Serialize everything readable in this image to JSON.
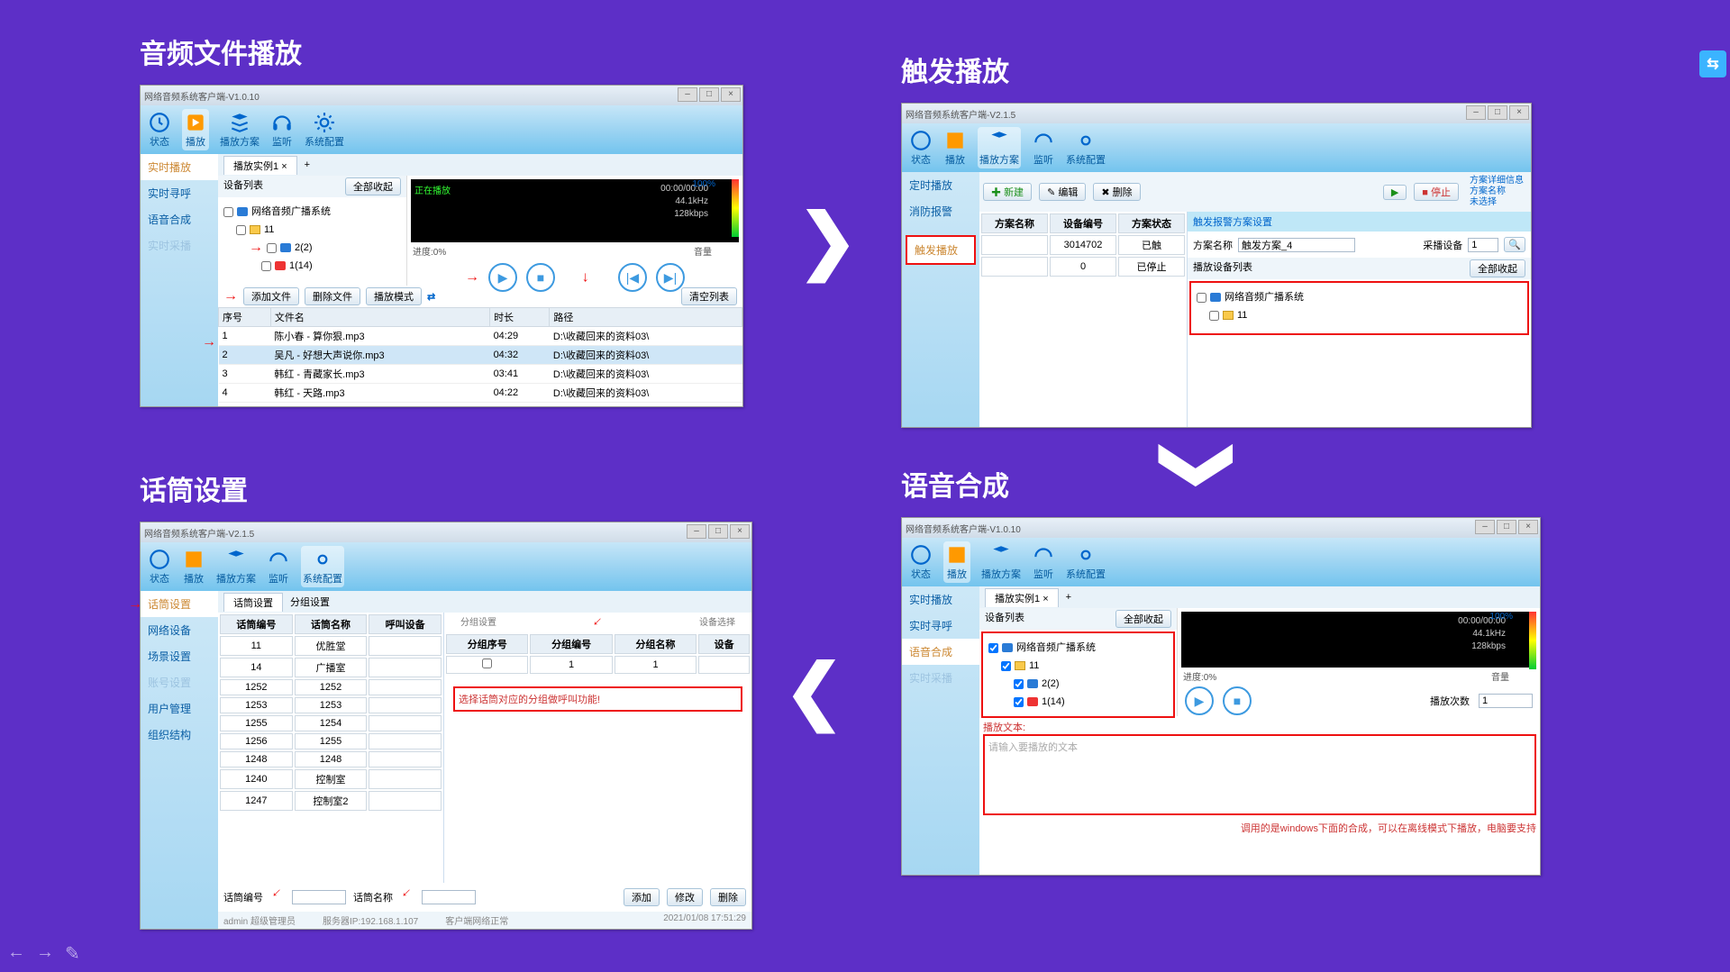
{
  "share_icon": "⇆",
  "nav": {
    "prev": "←",
    "next": "→",
    "pen": "✎"
  },
  "panel1": {
    "title": "音频文件播放",
    "win_title": "网络音频系统客户端-V1.0.10",
    "toolbar": [
      "状态",
      "播放",
      "播放方案",
      "监听",
      "系统配置"
    ],
    "left": [
      "实时播放",
      "实时寻呼",
      "语音合成",
      "实时采播"
    ],
    "tab": "播放实例1",
    "tab_close": "×",
    "tab_add": "+",
    "tree_header": "设备列表",
    "expand_all": "全部收起",
    "tree": {
      "root": "网络音频广播系统",
      "g1": "11",
      "s1": "2(2)",
      "s2": "1(14)"
    },
    "player": {
      "status": "正在播放",
      "time": "00:00/00:00",
      "pct": "100%",
      "rate": "44.1kHz",
      "bps": "128kbps",
      "prog": "进度:0%",
      "vol": "音量"
    },
    "btns": {
      "addfile": "添加文件",
      "delfile": "删除文件",
      "mode": "播放模式",
      "clear": "清空列表"
    },
    "cols": [
      "序号",
      "文件名",
      "时长",
      "路径"
    ],
    "rows": [
      [
        "1",
        "陈小春 - 算你狠.mp3",
        "04:29",
        "D:\\收藏回来的资料03\\"
      ],
      [
        "2",
        "吴凡 - 好想大声说你.mp3",
        "04:32",
        "D:\\收藏回来的资料03\\"
      ],
      [
        "3",
        "韩红 - 青藏家长.mp3",
        "03:41",
        "D:\\收藏回来的资料03\\"
      ],
      [
        "4",
        "韩红 - 天路.mp3",
        "04:22",
        "D:\\收藏回来的资料03\\"
      ]
    ]
  },
  "panel2": {
    "title": "触发播放",
    "win_title": "网络音频系统客户端-V2.1.5",
    "toolbar": [
      "状态",
      "播放",
      "播放方案",
      "监听",
      "系统配置"
    ],
    "left": [
      "定时播放",
      "消防报警",
      "触发播放"
    ],
    "btns": {
      "new": "新建",
      "edit": "编辑",
      "del": "删除",
      "play": "▶",
      "stop": "■ 停止"
    },
    "info": [
      "方案详细信息",
      "方案名称",
      "未选择"
    ],
    "cols": [
      "方案名称",
      "设备编号",
      "方案状态"
    ],
    "rows": [
      [
        "",
        "3014702",
        "已触"
      ],
      [
        "",
        "0",
        "已停止"
      ]
    ],
    "sub": {
      "header": "触发报警方案设置",
      "name_lbl": "方案名称",
      "name_val": "触发方案_4",
      "rec_lbl": "采播设备",
      "rec_val": "1",
      "tree_hdr": "播放设备列表",
      "expand": "全部收起",
      "root": "网络音频广播系统",
      "g1": "11"
    }
  },
  "panel3": {
    "title": "话筒设置",
    "win_title": "网络音频系统客户端-V2.1.5",
    "toolbar": [
      "状态",
      "播放",
      "播放方案",
      "监听",
      "系统配置"
    ],
    "left": [
      "话筒设置",
      "网络设备",
      "场景设置",
      "账号设置",
      "用户管理",
      "组织结构"
    ],
    "tabs": [
      "话筒设置",
      "分组设置"
    ],
    "cols1": [
      "话筒编号",
      "话筒名称",
      "呼叫设备"
    ],
    "rows1": [
      [
        "11",
        "优胜堂",
        ""
      ],
      [
        "14",
        "广播室",
        ""
      ],
      [
        "1252",
        "1252",
        ""
      ],
      [
        "1253",
        "1253",
        ""
      ],
      [
        "1255",
        "1254",
        ""
      ],
      [
        "1256",
        "1255",
        ""
      ],
      [
        "1248",
        "1248",
        ""
      ],
      [
        "1240",
        "控制室",
        ""
      ],
      [
        "1247",
        "控制室2",
        ""
      ]
    ],
    "cols2": [
      "分组序号",
      "分组编号",
      "分组名称",
      "设备"
    ],
    "rows2": [
      [
        "",
        "1",
        "1",
        ""
      ]
    ],
    "hint": "选择话筒对应的分组做呼叫功能!",
    "col2hdr": "分组设置",
    "col2sel": "设备选择",
    "foot": {
      "numlbl": "话筒编号",
      "namelbl": "话筒名称",
      "add": "添加",
      "mod": "修改",
      "del": "删除"
    },
    "status": [
      "admin 超级管理员",
      "服务器IP:192.168.1.107",
      "客户端网络正常",
      "2021/01/08 17:51:29"
    ]
  },
  "panel4": {
    "title": "语音合成",
    "win_title": "网络音频系统客户端-V1.0.10",
    "toolbar": [
      "状态",
      "播放",
      "播放方案",
      "监听",
      "系统配置"
    ],
    "left": [
      "实时播放",
      "实时寻呼",
      "语音合成",
      "实时采播"
    ],
    "tab": "播放实例1",
    "tab_close": "×",
    "tab_add": "+",
    "tree_header": "设备列表",
    "expand_all": "全部收起",
    "tree": {
      "root": "网络音频广播系统",
      "g1": "11",
      "s1": "2(2)",
      "s2": "1(14)"
    },
    "player": {
      "time": "00:00/00:00",
      "pct": "100%",
      "rate": "44.1kHz",
      "bps": "128kbps",
      "prog": "进度:0%",
      "vol": "音量"
    },
    "repeat_lbl": "播放次数",
    "repeat_val": "1",
    "text_lbl": "播放文本:",
    "placeholder": "请输入要播放的文本",
    "note": "调用的是windows下面的合成，可以在离线模式下播放，电脑要支持"
  }
}
